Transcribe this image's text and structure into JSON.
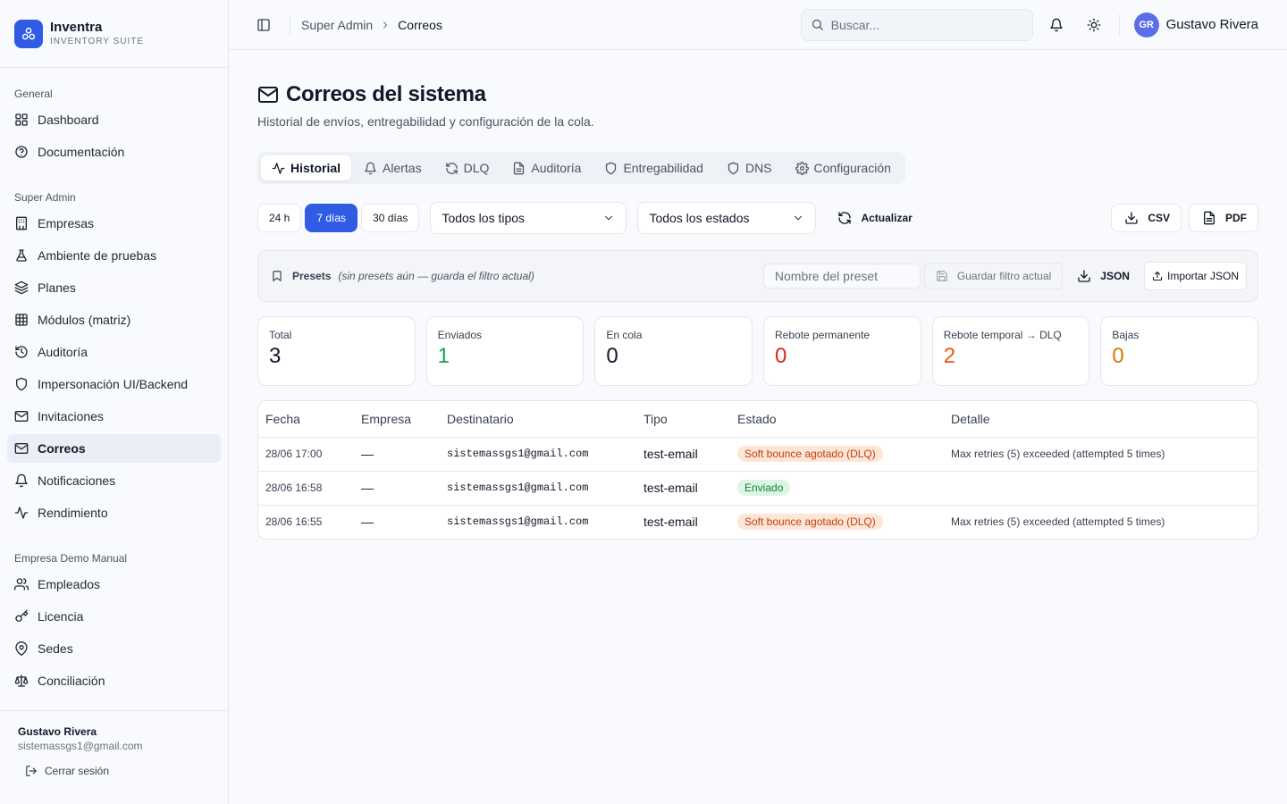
{
  "brand": {
    "name": "Inventra",
    "subtitle": "INVENTORY SUITE"
  },
  "sidebar": {
    "sections": [
      {
        "heading": "General",
        "items": [
          {
            "label": "Dashboard",
            "icon": "grid-icon"
          },
          {
            "label": "Documentación",
            "icon": "help-circle-icon"
          }
        ]
      },
      {
        "heading": "Super Admin",
        "items": [
          {
            "label": "Empresas",
            "icon": "building-icon"
          },
          {
            "label": "Ambiente de pruebas",
            "icon": "flask-icon"
          },
          {
            "label": "Planes",
            "icon": "layers-icon"
          },
          {
            "label": "Módulos (matriz)",
            "icon": "table-icon"
          },
          {
            "label": "Auditoría",
            "icon": "history-icon"
          },
          {
            "label": "Impersonación UI/Backend",
            "icon": "shield-icon"
          },
          {
            "label": "Invitaciones",
            "icon": "mail-icon"
          },
          {
            "label": "Correos",
            "icon": "mail-icon",
            "active": true
          },
          {
            "label": "Notificaciones",
            "icon": "bell-icon"
          },
          {
            "label": "Rendimiento",
            "icon": "activity-icon"
          }
        ]
      },
      {
        "heading": "Empresa Demo Manual",
        "items": [
          {
            "label": "Empleados",
            "icon": "users-icon"
          },
          {
            "label": "Licencia",
            "icon": "key-icon"
          },
          {
            "label": "Sedes",
            "icon": "map-pin-icon"
          },
          {
            "label": "Conciliación",
            "icon": "scale-icon"
          }
        ]
      }
    ],
    "footer": {
      "user_name": "Gustavo Rivera",
      "user_email": "sistemassgs1@gmail.com",
      "logout_label": "Cerrar sesión"
    }
  },
  "topbar": {
    "breadcrumb": [
      "Super Admin",
      "Correos"
    ],
    "search_placeholder": "Buscar...",
    "user": {
      "initials": "GR",
      "name": "Gustavo Rivera"
    }
  },
  "page": {
    "title": "Correos del sistema",
    "subtitle": "Historial de envíos, entregabilidad y configuración de la cola."
  },
  "tabs": [
    {
      "label": "Historial",
      "icon": "activity-icon",
      "active": true
    },
    {
      "label": "Alertas",
      "icon": "bell-icon"
    },
    {
      "label": "DLQ",
      "icon": "refresh-icon"
    },
    {
      "label": "Auditoría",
      "icon": "file-icon"
    },
    {
      "label": "Entregabilidad",
      "icon": "shield-icon"
    },
    {
      "label": "DNS",
      "icon": "shield-icon"
    },
    {
      "label": "Configuración",
      "icon": "gear-icon"
    }
  ],
  "filters": {
    "ranges": [
      {
        "label": "24 h"
      },
      {
        "label": "7 días",
        "active": true
      },
      {
        "label": "30 días"
      }
    ],
    "type_select": "Todos los tipos",
    "status_select": "Todos los estados",
    "refresh_label": "Actualizar",
    "csv_label": "CSV",
    "pdf_label": "PDF"
  },
  "presets": {
    "label": "Presets",
    "empty_text": "(sin presets aún — guarda el filtro actual)",
    "name_placeholder": "Nombre del preset",
    "save_label": "Guardar filtro actual",
    "json_label": "JSON",
    "import_label": "Importar JSON"
  },
  "stats": [
    {
      "label": "Total",
      "value": "3",
      "color": "#111827"
    },
    {
      "label": "Enviados",
      "value": "1",
      "color": "#16a34a"
    },
    {
      "label": "En cola",
      "value": "0",
      "color": "#111827"
    },
    {
      "label": "Rebote permanente",
      "value": "0",
      "color": "#dc2626"
    },
    {
      "label": "Rebote temporal → DLQ",
      "value": "2",
      "color": "#ea580c"
    },
    {
      "label": "Bajas",
      "value": "0",
      "color": "#d97706"
    }
  ],
  "table": {
    "columns": [
      "Fecha",
      "Empresa",
      "Destinatario",
      "Tipo",
      "Estado",
      "Detalle"
    ],
    "rows": [
      {
        "fecha": "28/06 17:00",
        "empresa": "—",
        "destinatario": "sistemassgs1@gmail.com",
        "tipo": "test-email",
        "estado": "Soft bounce agotado (DLQ)",
        "estado_kind": "warn",
        "detalle": "Max retries (5) exceeded (attempted 5 times)"
      },
      {
        "fecha": "28/06 16:58",
        "empresa": "—",
        "destinatario": "sistemassgs1@gmail.com",
        "tipo": "test-email",
        "estado": "Enviado",
        "estado_kind": "ok",
        "detalle": ""
      },
      {
        "fecha": "28/06 16:55",
        "empresa": "—",
        "destinatario": "sistemassgs1@gmail.com",
        "tipo": "test-email",
        "estado": "Soft bounce agotado (DLQ)",
        "estado_kind": "warn",
        "detalle": "Max retries (5) exceeded (attempted 5 times)"
      }
    ]
  },
  "colors": {
    "accent": "#2f5be5",
    "badge_warn_bg": "#fde5d8",
    "badge_warn_fg": "#c2410c",
    "badge_ok_bg": "#dcf5e4",
    "badge_ok_fg": "#15803d"
  }
}
